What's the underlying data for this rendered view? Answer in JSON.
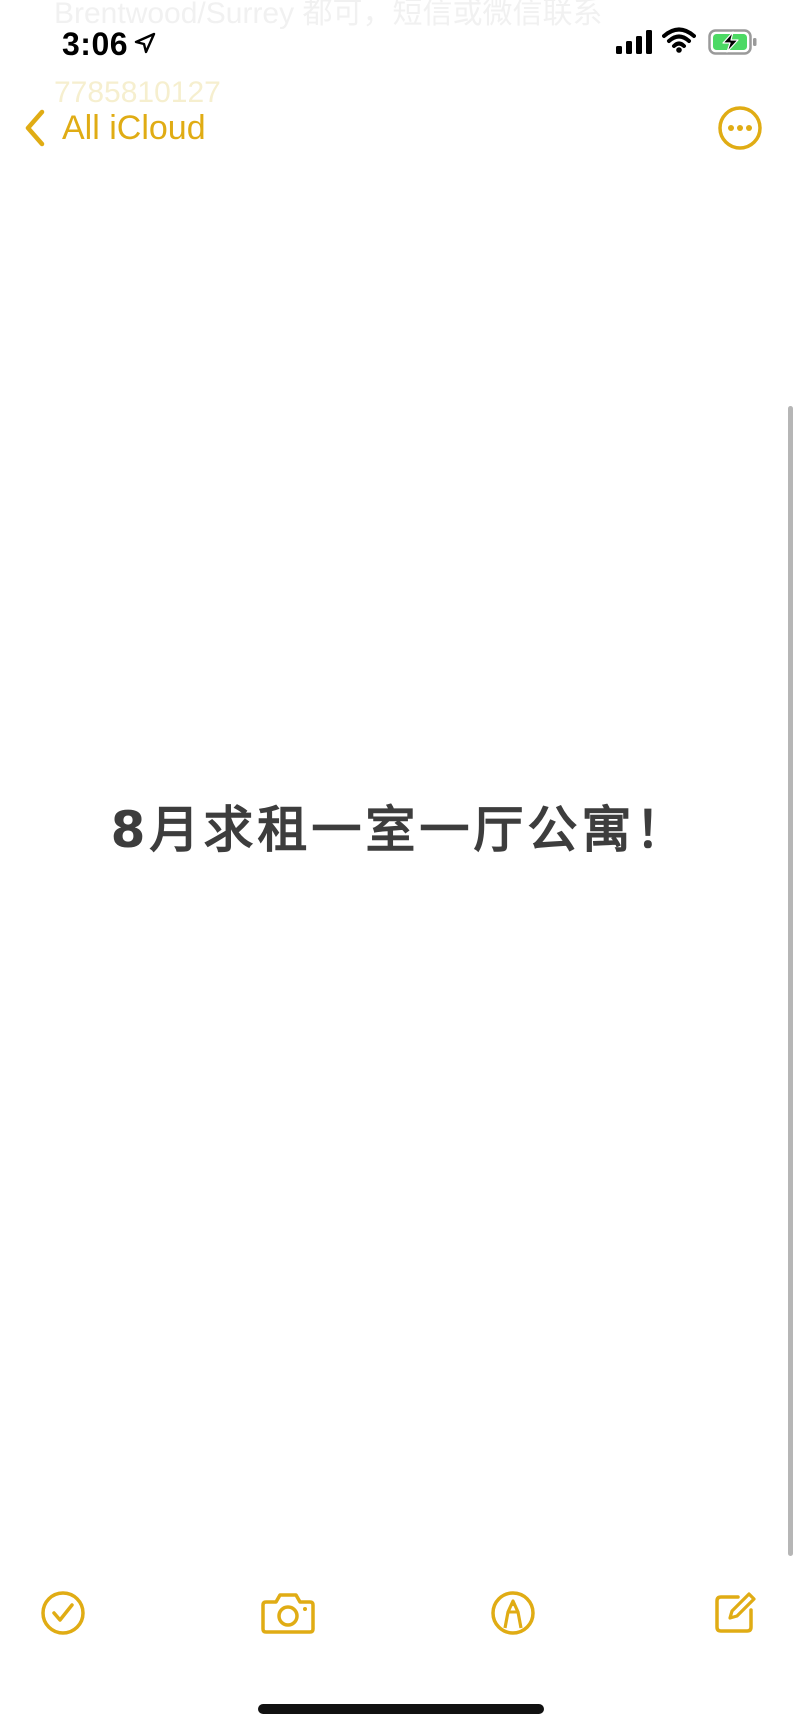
{
  "status_bar": {
    "time": "3:06",
    "icons": [
      "location-arrow-icon",
      "cellular-signal-icon",
      "wifi-icon",
      "battery-charging-icon"
    ],
    "battery_color": "#4cd964"
  },
  "background_text": {
    "line1": "Brentwood/Surrey 都可，短信或微信联系",
    "line2": "7785810127"
  },
  "nav": {
    "back_label": "All iCloud",
    "more_icon": "ellipsis-circle-icon"
  },
  "note": {
    "title": "8月求租一室一厅公寓！"
  },
  "toolbar": {
    "items": [
      "checklist-icon",
      "camera-icon",
      "markup-icon",
      "compose-icon"
    ]
  },
  "colors": {
    "accent": "#e0ac14",
    "text": "#3d3d3d",
    "background": "#ffffff"
  }
}
